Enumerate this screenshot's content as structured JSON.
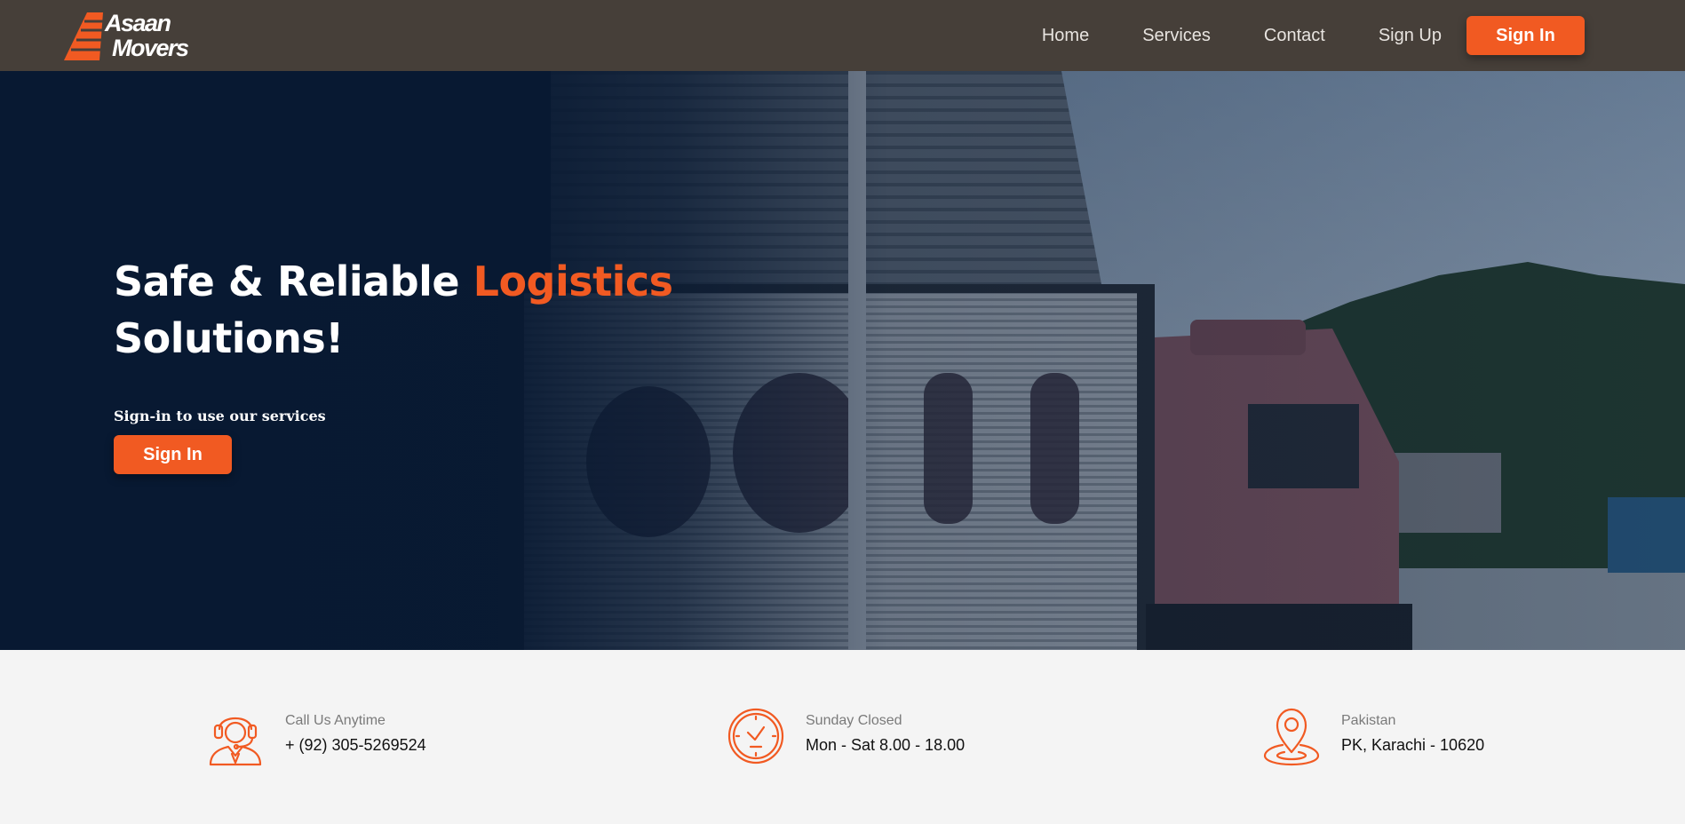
{
  "brand": {
    "line1": "Asaan",
    "line2": "Movers",
    "accent_color": "#f15a22"
  },
  "nav": {
    "items": [
      {
        "label": "Home"
      },
      {
        "label": "Services"
      },
      {
        "label": "Contact"
      },
      {
        "label": "Sign Up"
      }
    ],
    "signin_label": "Sign In",
    "background": "#463f39"
  },
  "hero": {
    "title_part1": "Safe & Reliable ",
    "title_accent": "Logistics",
    "title_part2": "Solutions!",
    "subtitle": "Sign-in to use our services",
    "signin_label": "Sign In",
    "background_image": "truck-at-loading-dock"
  },
  "info": {
    "items": [
      {
        "label": "Call Us Anytime",
        "value": "+ (92) 305-5269524",
        "icon": "headset-agent-icon"
      },
      {
        "label": "Sunday Closed",
        "value": "Mon - Sat 8.00 - 18.00",
        "icon": "clock-icon"
      },
      {
        "label": "Pakistan",
        "value": "PK, Karachi - 10620",
        "icon": "location-pin-icon"
      }
    ]
  }
}
